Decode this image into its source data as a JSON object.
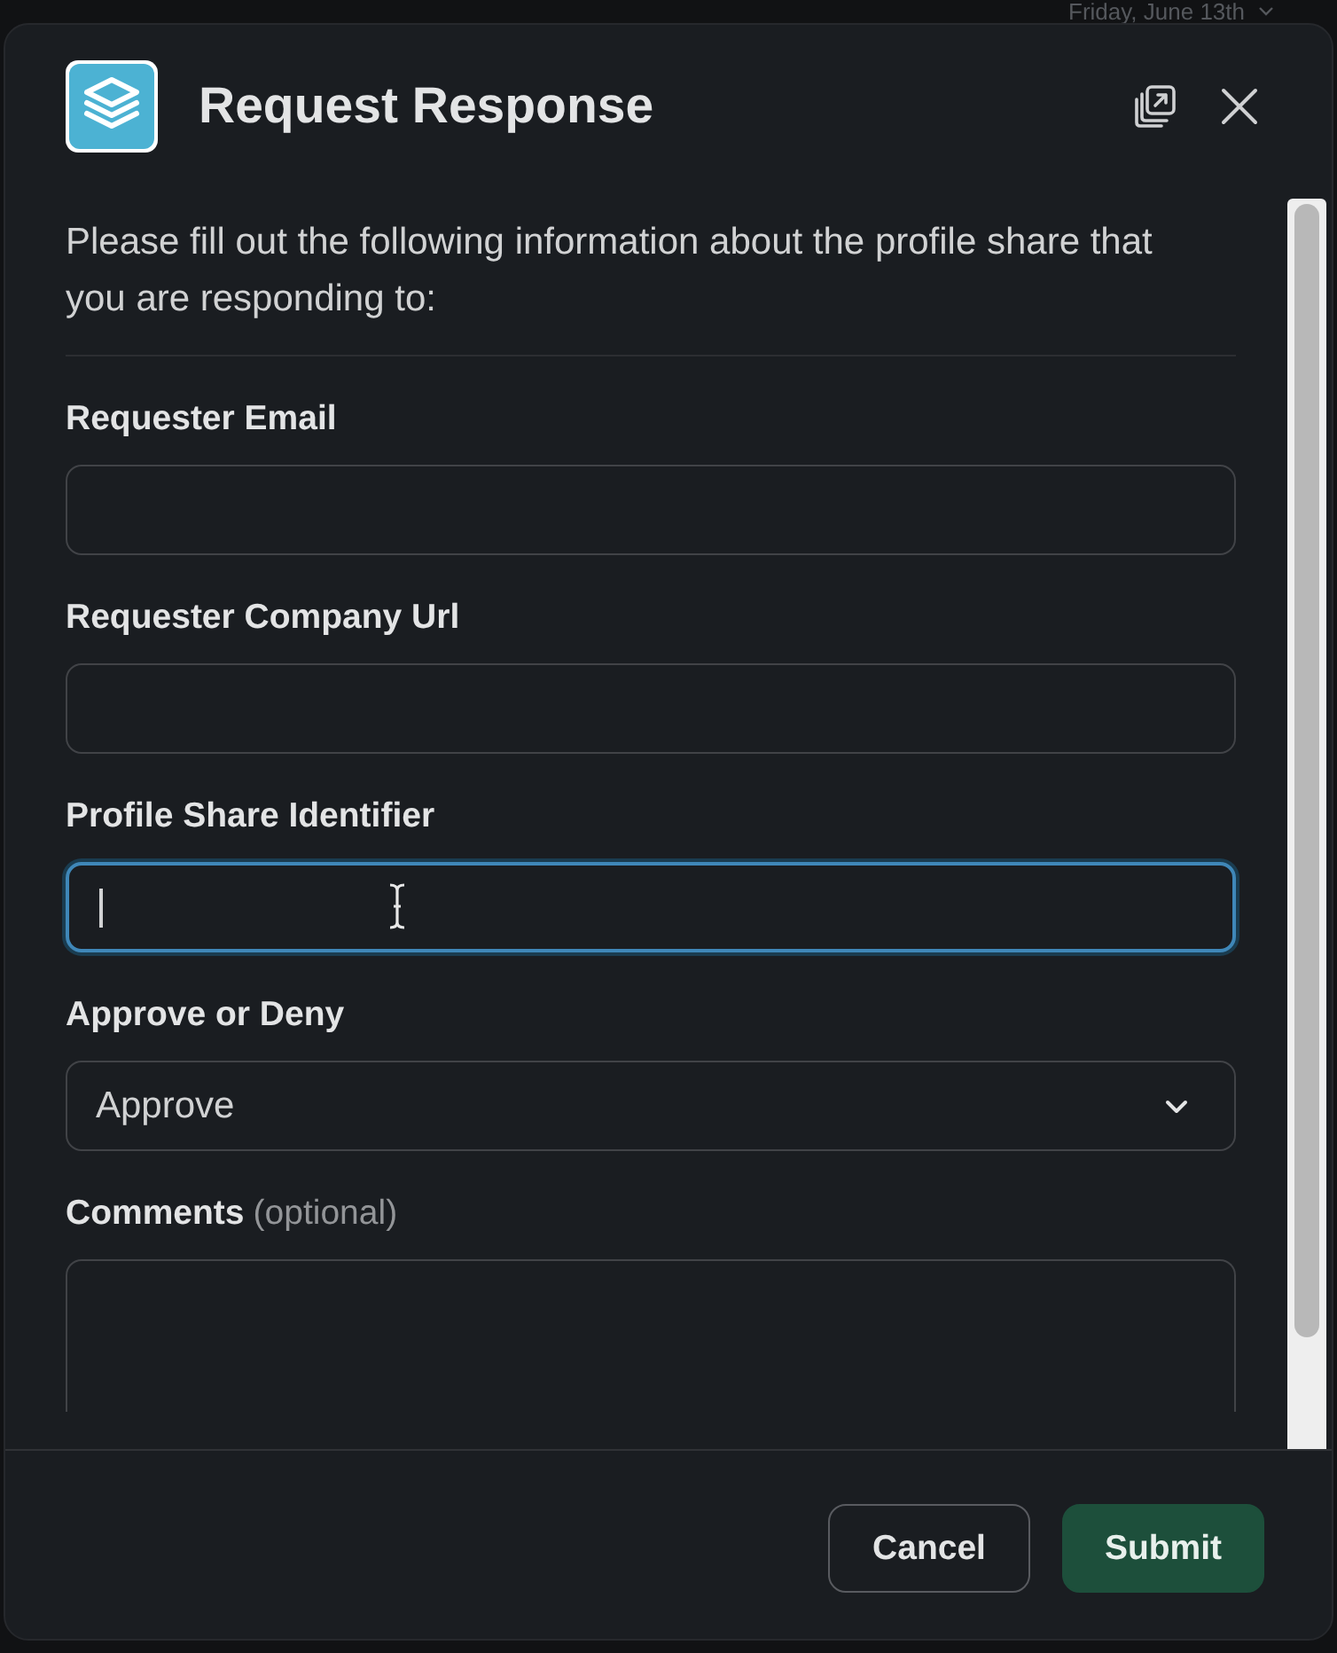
{
  "background": {
    "date": "Friday, June 13th"
  },
  "modal": {
    "title": "Request Response",
    "description": "Please fill out the following information about the profile share that you are responding to:",
    "fields": [
      {
        "kind": "text",
        "label": "Requester Email",
        "focused": false
      },
      {
        "kind": "text",
        "label": "Requester Company Url",
        "focused": false
      },
      {
        "kind": "text",
        "label": "Profile Share Identifier",
        "focused": true
      },
      {
        "kind": "select",
        "label": "Approve or Deny",
        "value": "Approve",
        "focused": false
      },
      {
        "kind": "textarea",
        "label": "Comments",
        "hint": "(optional)",
        "focused": false
      }
    ],
    "buttons": [
      {
        "kind": "secondary",
        "label": "Cancel"
      },
      {
        "kind": "primary",
        "label": "Submit"
      }
    ]
  }
}
